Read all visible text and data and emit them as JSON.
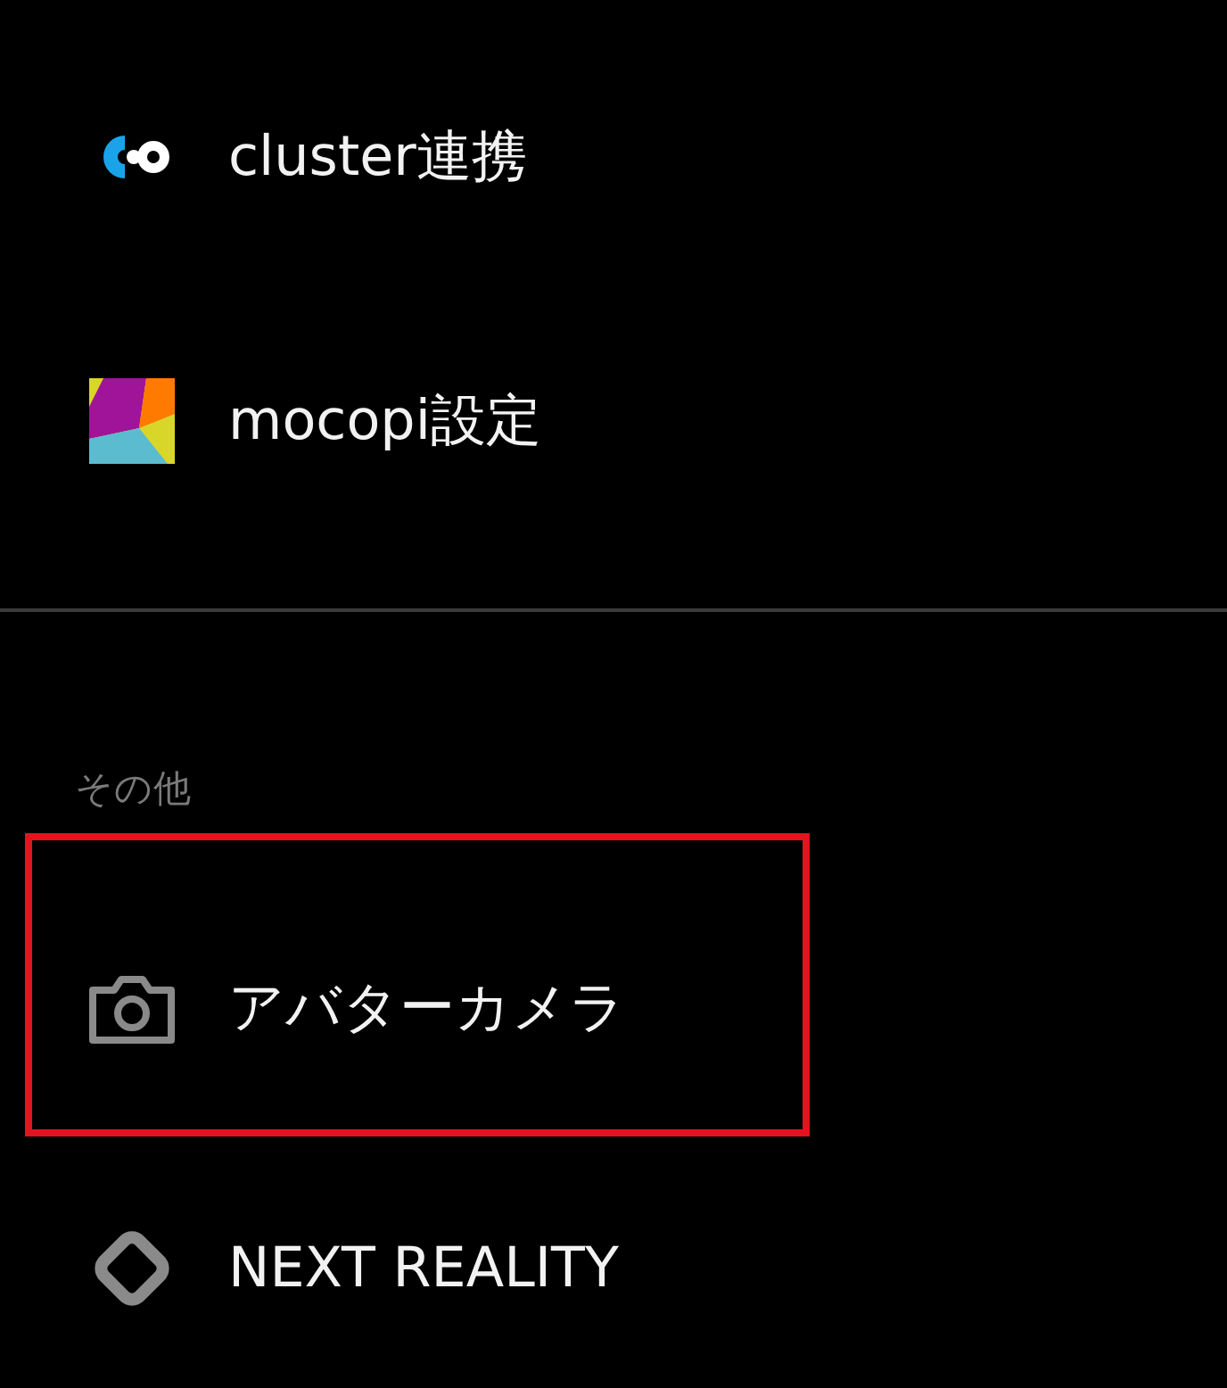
{
  "menu_items": [
    {
      "kind": "cluster",
      "label": "cluster連携",
      "highlighted": false
    },
    {
      "kind": "mocopi",
      "label": "mocopi設定",
      "highlighted": false
    }
  ],
  "section": {
    "title": "その他",
    "items": [
      {
        "kind": "camera",
        "label": "アバターカメラ",
        "highlighted": true
      },
      {
        "kind": "diamond",
        "label": "NEXT REALITY",
        "highlighted": false
      }
    ]
  }
}
